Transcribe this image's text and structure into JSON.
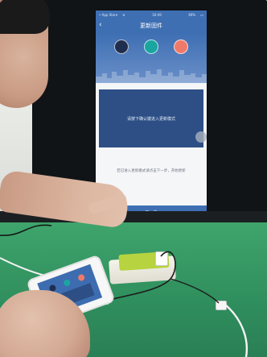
{
  "scene": {
    "mirrored_screen": {
      "status_bar": {
        "carrier": "• App Store",
        "time": "16:49",
        "battery": "69%"
      },
      "nav": {
        "back_icon": "chevron-left-icon",
        "title": "更新固件"
      },
      "hero": {
        "dot_colors": [
          "#1f2e4f",
          "#19a6a0",
          "#f07a6a"
        ]
      },
      "instruction": "请按下确认键进入更新模式",
      "hint": "若已进入更新模式请点击下一步，开始更新",
      "next_button": "下一步"
    },
    "phone": {
      "screen_title": "更新固件"
    },
    "colors": {
      "desk": "#2f8e5d",
      "app_blue": "#3e6fb3",
      "charger_green": "#b7d33f"
    }
  }
}
